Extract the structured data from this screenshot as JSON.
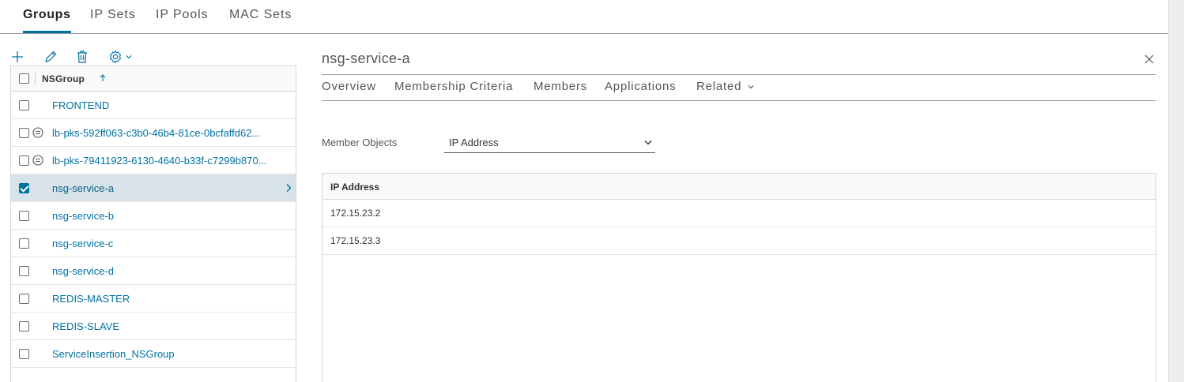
{
  "top_tabs": [
    {
      "label": "Groups",
      "active": true
    },
    {
      "label": "IP Sets",
      "active": false
    },
    {
      "label": "IP Pools",
      "active": false
    },
    {
      "label": "MAC Sets",
      "active": false
    }
  ],
  "toolbar": {
    "icons": [
      "plus-icon",
      "pencil-icon",
      "trash-icon",
      "gear-icon",
      "chevron-down-icon"
    ]
  },
  "grid": {
    "column_header": "NSGroup",
    "sort": "ascending",
    "rows": [
      {
        "label": "FRONTEND",
        "checked": false,
        "lb": false,
        "selected": false
      },
      {
        "label": "lb-pks-592ff063-c3b0-46b4-81ce-0bcfaffd62...",
        "checked": false,
        "lb": true,
        "selected": false
      },
      {
        "label": "lb-pks-79411923-6130-4640-b33f-c7299b870...",
        "checked": false,
        "lb": true,
        "selected": false
      },
      {
        "label": "nsg-service-a",
        "checked": true,
        "lb": false,
        "selected": true
      },
      {
        "label": "nsg-service-b",
        "checked": false,
        "lb": false,
        "selected": false
      },
      {
        "label": "nsg-service-c",
        "checked": false,
        "lb": false,
        "selected": false
      },
      {
        "label": "nsg-service-d",
        "checked": false,
        "lb": false,
        "selected": false
      },
      {
        "label": "REDIS-MASTER",
        "checked": false,
        "lb": false,
        "selected": false
      },
      {
        "label": "REDIS-SLAVE",
        "checked": false,
        "lb": false,
        "selected": false
      },
      {
        "label": "ServiceInsertion_NSGroup",
        "checked": false,
        "lb": false,
        "selected": false
      }
    ]
  },
  "detail": {
    "title": "nsg-service-a",
    "tabs": [
      {
        "label": "Overview"
      },
      {
        "label": "Membership Criteria"
      },
      {
        "label": "Members"
      },
      {
        "label": "Applications"
      },
      {
        "label": "Related"
      }
    ],
    "member_objects_label": "Member Objects",
    "member_objects_value": "IP Address",
    "table": {
      "header": "IP Address",
      "rows": [
        "172.15.23.2",
        "172.15.23.3"
      ]
    }
  },
  "colors": {
    "accent": "#0072a3",
    "selected_row": "#d8e3e9",
    "link_text": "#0072a3"
  }
}
